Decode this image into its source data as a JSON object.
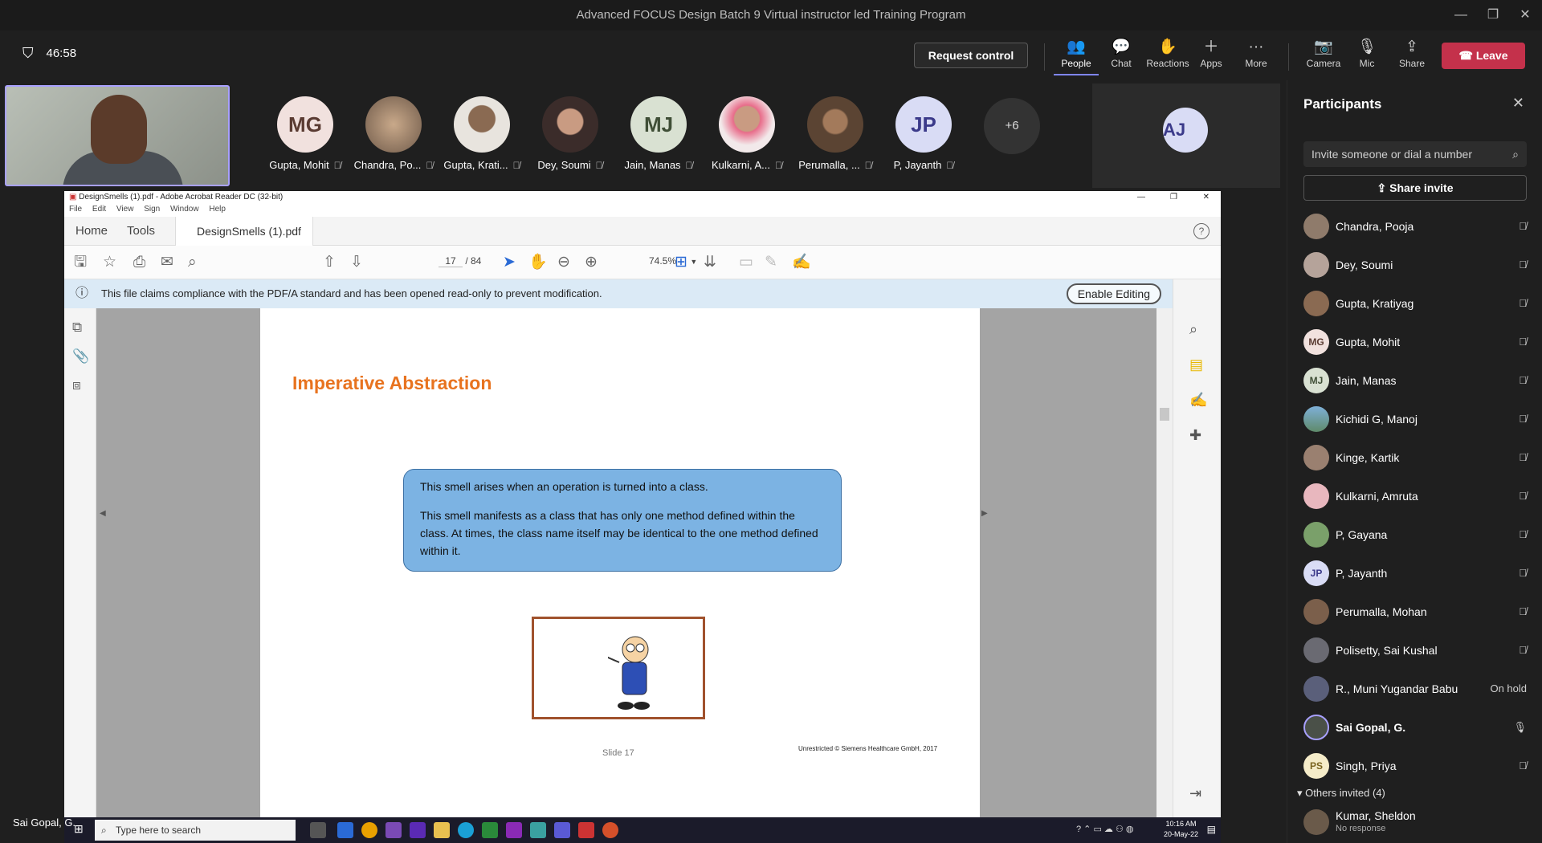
{
  "window": {
    "title": "Advanced FOCUS Design Batch 9 Virtual instructor led Training Program"
  },
  "meeting": {
    "timer": "46:58",
    "request_control": "Request control",
    "toolbar": [
      {
        "label": "People",
        "icon": "people-icon"
      },
      {
        "label": "Chat",
        "icon": "chat-icon"
      },
      {
        "label": "Reactions",
        "icon": "reactions-icon"
      },
      {
        "label": "Apps",
        "icon": "apps-icon"
      },
      {
        "label": "More",
        "icon": "more-icon"
      },
      {
        "label": "Camera",
        "icon": "camera-off-icon"
      },
      {
        "label": "Mic",
        "icon": "mic-off-icon"
      },
      {
        "label": "Share",
        "icon": "share-icon"
      }
    ],
    "leave": "Leave"
  },
  "gallery": {
    "tiles": [
      {
        "name": "Gupta, Mohit",
        "initials": "MG",
        "bg": "#f1e1de",
        "fg": "#5a3b32"
      },
      {
        "name": "Chandra, Po...",
        "initials": "",
        "bg": "#8f7b6b",
        "fg": "#fff"
      },
      {
        "name": "Gupta, Krati...",
        "initials": "",
        "bg": "#d9d3cc",
        "fg": "#fff"
      },
      {
        "name": "Dey, Soumi",
        "initials": "",
        "bg": "#b5a39a",
        "fg": "#fff"
      },
      {
        "name": "Jain, Manas",
        "initials": "MJ",
        "bg": "#d9e1d2",
        "fg": "#3f4e36"
      },
      {
        "name": "Kulkarni, A...",
        "initials": "",
        "bg": "#e8b7be",
        "fg": "#fff"
      },
      {
        "name": "Perumalla, ...",
        "initials": "",
        "bg": "#7b5f4b",
        "fg": "#fff"
      },
      {
        "name": "P, Jayanth",
        "initials": "JP",
        "bg": "#d9dcf5",
        "fg": "#3b3a8a"
      }
    ],
    "more_count": "+6",
    "spotlight_initials": "AJ",
    "self_name": "Sai Gopal, G."
  },
  "panel": {
    "title": "Participants",
    "invite_placeholder": "Invite someone or dial a number",
    "share_invite": "Share invite",
    "participants": [
      {
        "name": "Chandra, Pooja",
        "initials": "",
        "bg": "#8f7b6b",
        "status": "mic-off"
      },
      {
        "name": "Dey, Soumi",
        "initials": "",
        "bg": "#b5a39a",
        "status": "mic-off"
      },
      {
        "name": "Gupta, Kratiyag",
        "initials": "",
        "bg": "#8a6a52",
        "status": "mic-off"
      },
      {
        "name": "Gupta, Mohit",
        "initials": "MG",
        "bg": "#f1e1de",
        "status": "mic-off"
      },
      {
        "name": "Jain, Manas",
        "initials": "MJ",
        "bg": "#d9e1d2",
        "status": "mic-off"
      },
      {
        "name": "Kichidi G, Manoj",
        "initials": "",
        "bg": "#5f8a6a",
        "status": "mic-off"
      },
      {
        "name": "Kinge, Kartik",
        "initials": "",
        "bg": "#9a8070",
        "status": "mic-off"
      },
      {
        "name": "Kulkarni, Amruta",
        "initials": "",
        "bg": "#e8b7be",
        "status": "mic-off"
      },
      {
        "name": "P, Gayana",
        "initials": "",
        "bg": "#7aa06a",
        "status": "mic-off"
      },
      {
        "name": "P, Jayanth",
        "initials": "JP",
        "bg": "#d9dcf5",
        "status": "mic-off"
      },
      {
        "name": "Perumalla, Mohan",
        "initials": "",
        "bg": "#7b5f4b",
        "status": "mic-off"
      },
      {
        "name": "Polisetty, Sai Kushal",
        "initials": "",
        "bg": "#6a6a72",
        "status": "mic-off"
      },
      {
        "name": "R., Muni Yugandar Babu",
        "initials": "",
        "bg": "#5a5f7a",
        "status": "On hold"
      },
      {
        "name": "Sai Gopal, G.",
        "initials": "",
        "bg": "#4a5048",
        "status": "mic-on",
        "bold": true
      },
      {
        "name": "Singh, Priya",
        "initials": "PS",
        "bg": "#f5ecc9",
        "status": "mic-off"
      }
    ],
    "others_invited": "Others invited (4)",
    "invited": [
      {
        "name": "Kumar, Sheldon",
        "status": "No response"
      }
    ]
  },
  "acrobat": {
    "title": "DesignSmells (1).pdf - Adobe Acrobat Reader DC (32-bit)",
    "menu": [
      "File",
      "Edit",
      "View",
      "Sign",
      "Window",
      "Help"
    ],
    "tabs": {
      "home": "Home",
      "tools": "Tools",
      "doc": "DesignSmells (1).pdf"
    },
    "page_current": "17",
    "page_total": "/ 84",
    "zoom": "74.5%",
    "info_text": "This file claims compliance with the PDF/A standard and has been opened read-only to prevent modification.",
    "enable_editing": "Enable Editing",
    "slide": {
      "title": "Imperative Abstraction",
      "para1": "This smell arises when an operation is turned into a class.",
      "para2": "This smell manifests as a class that has only one method defined within the class. At times, the class name itself may be identical to the one method defined within it.",
      "slide_no": "Slide 17",
      "copyright": "Unrestricted © Siemens Healthcare GmbH, 2017"
    }
  },
  "taskbar": {
    "search_placeholder": "Type here to search",
    "time": "10:16 AM",
    "date": "20-May-22"
  }
}
